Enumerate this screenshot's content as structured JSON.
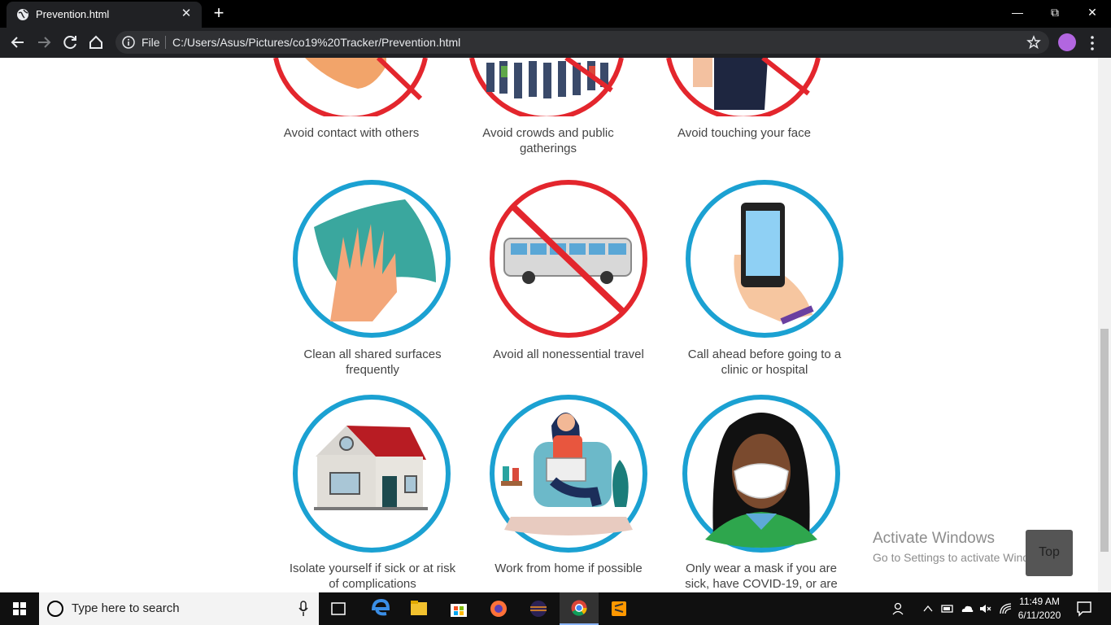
{
  "browser": {
    "tab_title": "Prevention.html",
    "new_tab_label": "+",
    "omnibox_scheme": "File",
    "omnibox_url": "C:/Users/Asus/Pictures/co19%20Tracker/Prevention.html"
  },
  "page": {
    "top_row": [
      {
        "caption": "Avoid contact with others"
      },
      {
        "caption": "Avoid crowds and public gatherings"
      },
      {
        "caption": "Avoid touching your face"
      }
    ],
    "middle_row": [
      {
        "caption": "Clean all shared surfaces frequently"
      },
      {
        "caption": "Avoid all nonessential travel"
      },
      {
        "caption": "Call ahead before going to a clinic or hospital"
      }
    ],
    "bottom_row": [
      {
        "caption": "Isolate yourself if sick or at risk of complications"
      },
      {
        "caption": "Work from home if possible"
      },
      {
        "caption": "Only wear a mask if you are sick, have COVID-19, or are"
      }
    ],
    "top_button": "Top"
  },
  "watermark": {
    "title": "Activate Windows",
    "subtitle": "Go to Settings to activate Windows."
  },
  "taskbar": {
    "search_placeholder": "Type here to search",
    "time": "11:49 AM",
    "date": "6/11/2020"
  },
  "colors": {
    "ban_red": "#e3262d",
    "ring_blue": "#1ba1d2"
  }
}
